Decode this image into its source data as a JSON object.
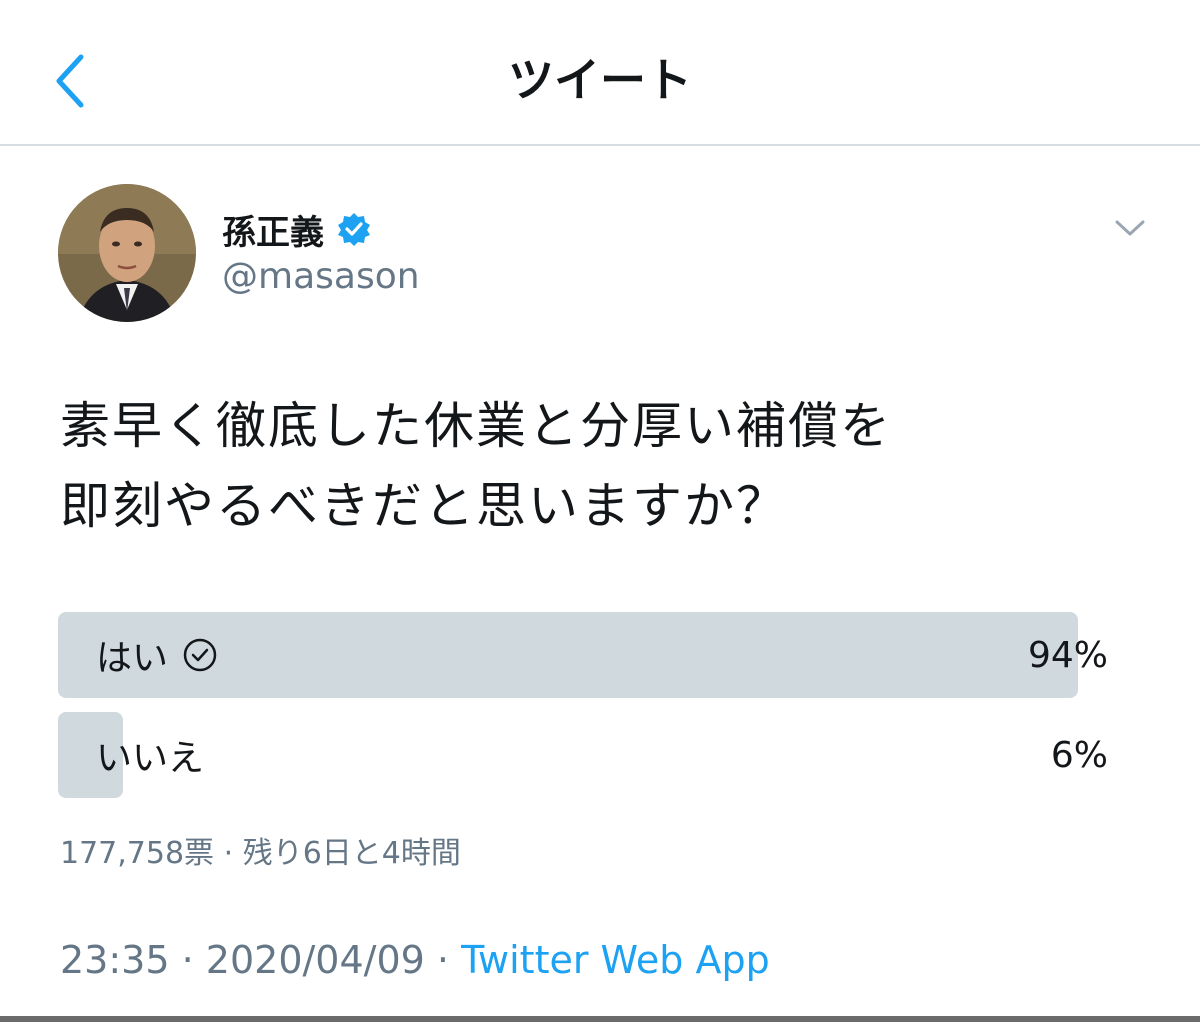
{
  "nav": {
    "title": "ツイート"
  },
  "tweet": {
    "author": {
      "display_name": "孫正義",
      "handle": "@masason",
      "verified": true
    },
    "text_lines": [
      "素早く徹底した休業と分厚い補償を",
      "即刻やるべきだと思いますか？"
    ],
    "poll": {
      "options": [
        {
          "label": "はい",
          "percent_text": "94%",
          "percent": 94,
          "selected": true
        },
        {
          "label": "いいえ",
          "percent_text": "6%",
          "percent": 6,
          "selected": false
        }
      ],
      "votes_text": "177,758票",
      "separator": "·",
      "remaining_text": "残り6日と4時間"
    },
    "time": "23:35",
    "date": "2020/04/09",
    "separator": "·",
    "client": "Twitter Web App"
  },
  "colors": {
    "accent": "#1da1f2",
    "muted_text": "#657786",
    "poll_fill": "#cfd9de",
    "divider": "#d8dde2"
  },
  "icons": {
    "back": "chevron-left-icon",
    "verified": "verified-badge-icon",
    "menu": "chevron-down-icon",
    "voted": "check-circle-icon"
  }
}
